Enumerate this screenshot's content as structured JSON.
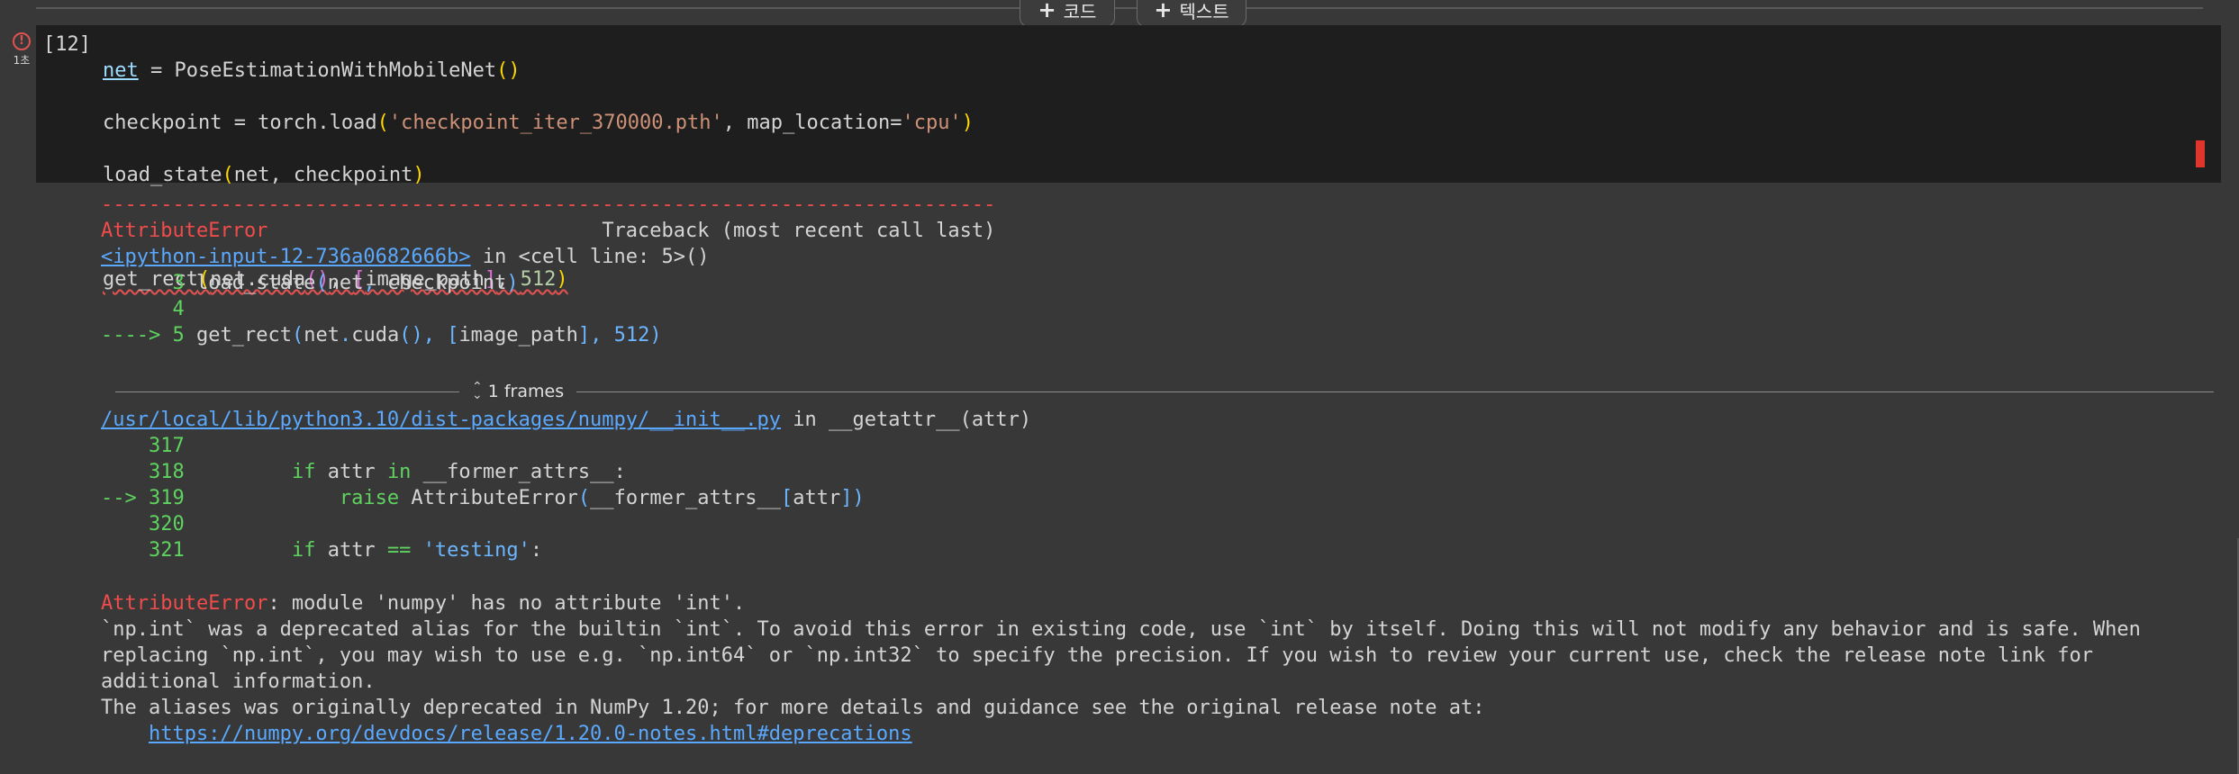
{
  "toolbar": {
    "add_code_label": "코드",
    "add_text_label": "텍스트"
  },
  "cell": {
    "execution_count": "[12]",
    "elapsed": "1초",
    "status": "error",
    "code_lines": [
      "net = PoseEstimationWithMobileNet()",
      "checkpoint = torch.load('checkpoint_iter_370000.pth', map_location='cpu')",
      "load_state(net, checkpoint)",
      "",
      "get_rect(net.cuda(), [image_path], 512)"
    ]
  },
  "output": {
    "separator": "---------------------------------------------------------------------------",
    "error_name": "AttributeError",
    "traceback_header": "Traceback (most recent call last)",
    "frame1": {
      "location_link": "<ipython-input-12-736a0682666b>",
      "location_suffix": " in <cell line: 5>()",
      "lines": [
        {
          "marker": "      ",
          "num": "3",
          "code": " load_state(net, checkpoint)"
        },
        {
          "marker": "      ",
          "num": "4",
          "code": ""
        },
        {
          "marker": "----> ",
          "num": "5",
          "code": " get_rect(net.cuda(), [image_path], 512)"
        }
      ]
    },
    "frames_toggle": "1 frames",
    "frame2": {
      "location_link": "/usr/local/lib/python3.10/dist-packages/numpy/__init__.py",
      "location_suffix": " in __getattr__(attr)",
      "lines": [
        {
          "marker": "    ",
          "num": "317",
          "code": ""
        },
        {
          "marker": "    ",
          "num": "318",
          "code": "         if attr in __former_attrs__:"
        },
        {
          "marker": "--> ",
          "num": "319",
          "code": "             raise AttributeError(__former_attrs__[attr])"
        },
        {
          "marker": "    ",
          "num": "320",
          "code": ""
        },
        {
          "marker": "    ",
          "num": "321",
          "code": "         if attr == 'testing':"
        }
      ]
    },
    "message_name": "AttributeError",
    "message_text": ": module 'numpy' has no attribute 'int'.",
    "message_detail": "`np.int` was a deprecated alias for the builtin `int`. To avoid this error in existing code, use `int` by itself. Doing this will not modify any behavior and is safe. When\nreplacing `np.int`, you may wish to use e.g. `np.int64` or `np.int32` to specify the precision. If you wish to review your current use, check the release note link for\nadditional information.\nThe aliases was originally deprecated in NumPy 1.20; for more details and guidance see the original release note at:",
    "release_note_indent": "    ",
    "release_note_link": "https://numpy.org/devdocs/release/1.20.0-notes.html#deprecations"
  },
  "colors": {
    "background": "#383838",
    "code_background": "#1e1e1e",
    "error": "#f14c4c",
    "link": "#5aa9ff",
    "line_number": "#5fd35f"
  }
}
